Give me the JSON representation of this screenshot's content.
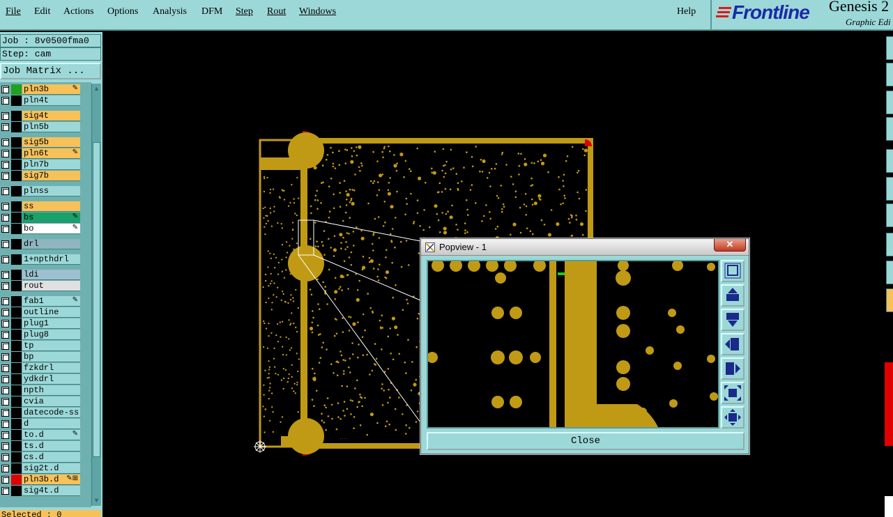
{
  "menu": {
    "items": [
      "File",
      "Edit",
      "Actions",
      "Options",
      "Analysis",
      "DFM",
      "Step",
      "Rout",
      "Windows"
    ],
    "help": "Help"
  },
  "brand": {
    "logo": "Frontline",
    "title": "Genesis 2",
    "subtitle": "Graphic Edi"
  },
  "job": {
    "job_line": "Job : 8v0500fma0",
    "step_line": "Step: cam",
    "matrix_button": "Job Matrix ..."
  },
  "layers": [
    {
      "name": "pln3b",
      "bg": "#f7c15a",
      "swatch": "#1fa01f",
      "mark": "✎"
    },
    {
      "name": "pln4t",
      "bg": "#9dd8d8",
      "swatch": "",
      "mark": ""
    },
    {
      "name": "sig4t",
      "bg": "#f7c15a",
      "swatch": "",
      "mark": ""
    },
    {
      "name": "pln5b",
      "bg": "#9dd8d8",
      "swatch": "",
      "mark": ""
    },
    {
      "name": "sig5b",
      "bg": "#f7c15a",
      "swatch": "",
      "mark": ""
    },
    {
      "name": "pln6t",
      "bg": "#f7c15a",
      "swatch": "",
      "mark": "✎"
    },
    {
      "name": "pln7b",
      "bg": "#9dd8d8",
      "swatch": "",
      "mark": ""
    },
    {
      "name": "sig7b",
      "bg": "#f7c15a",
      "swatch": "",
      "mark": ""
    },
    {
      "name": "plnss",
      "bg": "#9dd8d8",
      "swatch": "",
      "mark": ""
    },
    {
      "name": "ss",
      "bg": "#f7c15a",
      "swatch": "",
      "mark": ""
    },
    {
      "name": "bs",
      "bg": "#1aa06a",
      "swatch": "",
      "mark": "✎"
    },
    {
      "name": "bo",
      "bg": "#ffffff",
      "swatch": "",
      "mark": "✎"
    },
    {
      "name": "drl",
      "bg": "#8fb5c0",
      "swatch": "",
      "mark": ""
    },
    {
      "name": "1+npthdrl",
      "bg": "#9dd8d8",
      "swatch": "",
      "mark": ""
    },
    {
      "name": "ldi",
      "bg": "#9fc0d0",
      "swatch": "",
      "mark": ""
    },
    {
      "name": "rout",
      "bg": "#e0e0e0",
      "swatch": "",
      "mark": ""
    },
    {
      "name": "fab1",
      "bg": "#9dd8d8",
      "swatch": "",
      "mark": "✎"
    },
    {
      "name": "outline",
      "bg": "#9dd8d8",
      "swatch": "",
      "mark": ""
    },
    {
      "name": "plug1",
      "bg": "#9dd8d8",
      "swatch": "",
      "mark": ""
    },
    {
      "name": "plug8",
      "bg": "#9dd8d8",
      "swatch": "",
      "mark": ""
    },
    {
      "name": "tp",
      "bg": "#9dd8d8",
      "swatch": "",
      "mark": ""
    },
    {
      "name": "bp",
      "bg": "#9dd8d8",
      "swatch": "",
      "mark": ""
    },
    {
      "name": "fzkdrl",
      "bg": "#9dd8d8",
      "swatch": "",
      "mark": ""
    },
    {
      "name": "ydkdrl",
      "bg": "#9dd8d8",
      "swatch": "",
      "mark": ""
    },
    {
      "name": "npth",
      "bg": "#9dd8d8",
      "swatch": "",
      "mark": ""
    },
    {
      "name": "cvia",
      "bg": "#9dd8d8",
      "swatch": "",
      "mark": ""
    },
    {
      "name": "datecode-ss",
      "bg": "#9dd8d8",
      "swatch": "",
      "mark": ""
    },
    {
      "name": "d",
      "bg": "#9dd8d8",
      "swatch": "",
      "mark": ""
    },
    {
      "name": "to.d",
      "bg": "#9dd8d8",
      "swatch": "",
      "mark": "✎"
    },
    {
      "name": "ts.d",
      "bg": "#9dd8d8",
      "swatch": "",
      "mark": ""
    },
    {
      "name": "cs.d",
      "bg": "#9dd8d8",
      "swatch": "",
      "mark": ""
    },
    {
      "name": "sig2t.d",
      "bg": "#9dd8d8",
      "swatch": "",
      "mark": ""
    },
    {
      "name": "pln3b.d",
      "bg": "#f7c15a",
      "swatch": "#e00000",
      "mark": "✎⊞"
    },
    {
      "name": "sig4t.d",
      "bg": "#9dd8d8",
      "swatch": "",
      "mark": ""
    }
  ],
  "status": {
    "selected": "Selected : 0"
  },
  "popview": {
    "title": "Popview - 1",
    "close_x": "✕",
    "close_button": "Close",
    "tools": [
      "zoom-fit-icon",
      "pan-up-icon",
      "pan-down-icon",
      "pan-left-icon",
      "pan-right-icon",
      "zoom-in-icon",
      "zoom-out-icon"
    ]
  },
  "colors": {
    "menu_bg": "#9dd8d8",
    "copper": "#c09a14",
    "board_edge_red": "#e00000",
    "layer_active": "#f7c15a"
  }
}
